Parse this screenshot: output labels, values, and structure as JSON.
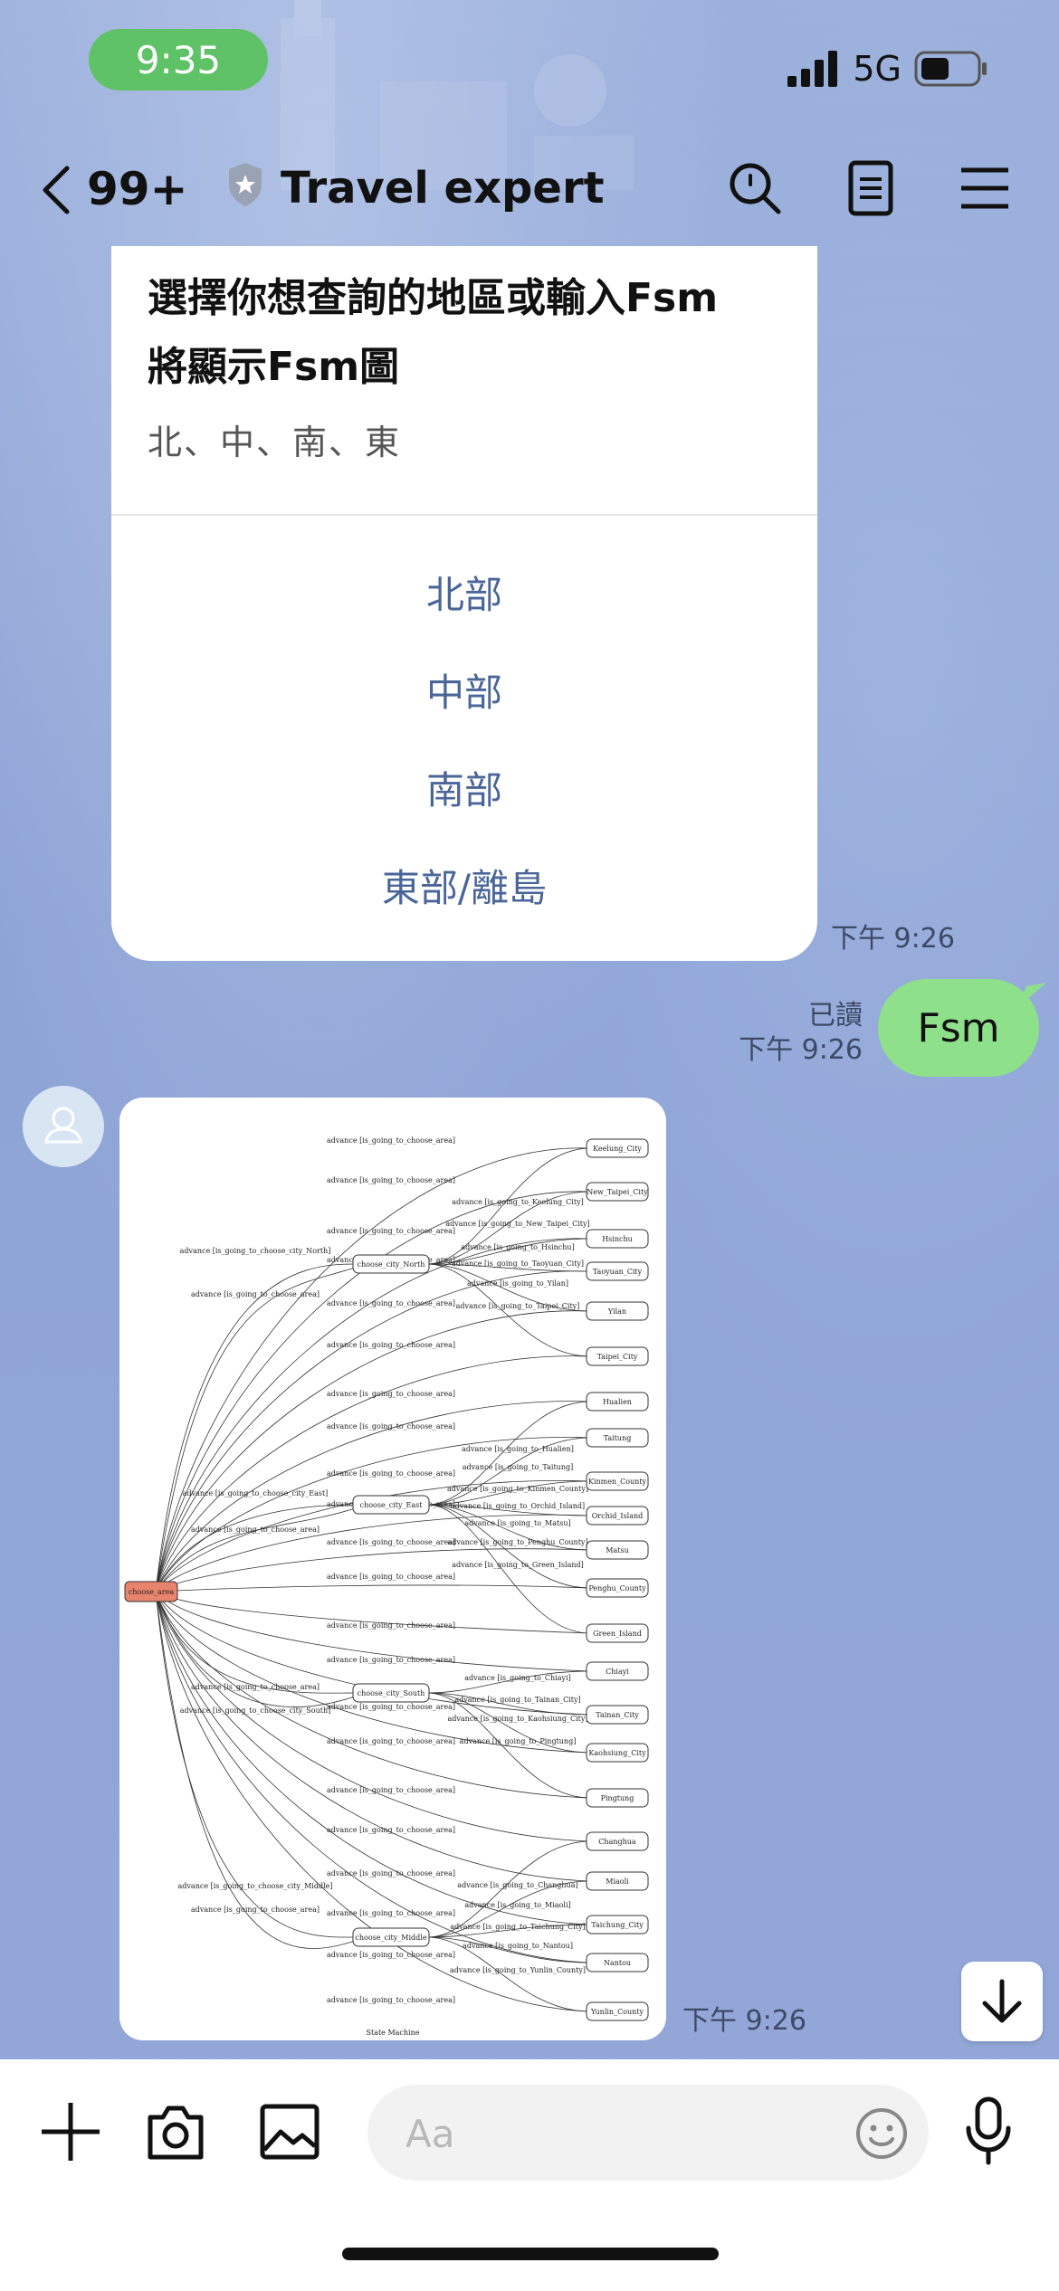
{
  "status": {
    "time": "9:35",
    "network": "5G"
  },
  "header": {
    "unread": "99+",
    "title": "Travel expert"
  },
  "card": {
    "title_line1": "選擇你想查詢的地區或輸入Fsm",
    "title_line2": "將顯示Fsm圖",
    "subtitle": "北、中、南、東",
    "options": [
      "北部",
      "中部",
      "南部",
      "東部/離島"
    ],
    "time": "下午 9:26"
  },
  "sent": {
    "text": "Fsm",
    "read": "已讀",
    "time": "下午 9:26"
  },
  "image_msg": {
    "time": "下午 9:26"
  },
  "fsm": {
    "root": "choose_area",
    "hubs": [
      "choose_city_North",
      "choose_city_East",
      "choose_city_South",
      "choose_city_Middle"
    ],
    "leaves": [
      "Keelung_City",
      "New_Taipei_City",
      "Hsinchu",
      "Taoyuan_City",
      "Yilan",
      "Taipei_City",
      "Hualien",
      "Taitung",
      "Kinmen_County",
      "Orchid_Island",
      "Matsu",
      "Penghu_County",
      "Green_Island",
      "Chiayi",
      "Tainan_City",
      "Kaohsiung_City",
      "Pingtung",
      "Changhua",
      "Miaoli",
      "Taichung_City",
      "Nantou",
      "Yunlin_County"
    ],
    "edge_back": "advance [is_going_to_choose_area]",
    "edge_north": "advance [is_going_to_choose_city_North]",
    "edge_east": "advance [is_going_to_choose_city_East]",
    "edge_south": "advance [is_going_to_choose_city_South]",
    "edge_middle": "advance [is_going_to_choose_city_Middle]",
    "leaf_edges": [
      "advance [is_going_to_Keelung_City]",
      "advance [is_going_to_New_Taipei_City]",
      "advance [is_going_to_Hsinchu]",
      "advance [is_going_to_Taoyuan_City]",
      "advance [is_going_to_Yilan]",
      "advance [is_going_to_Taipei_City]",
      "advance [is_going_to_Hualien]",
      "advance [is_going_to_Taitung]",
      "advance [is_going_to_Kinmen_County]",
      "advance [is_going_to_Orchid_Island]",
      "advance [is_going_to_Matsu]",
      "advance [is_going_to_Penghu_County]",
      "advance [is_going_to_Green_Island]",
      "advance [is_going_to_Chiayi]",
      "advance [is_going_to_Tainan_City]",
      "advance [is_going_to_Kaohsiung_City]",
      "advance [is_going_to_Pingtung]",
      "advance [is_going_to_Changhua]",
      "advance [is_going_to_Miaoli]",
      "advance [is_going_to_Taichung_City]",
      "advance [is_going_to_Nantou]",
      "advance [is_going_to_Yunlin_County]"
    ],
    "caption": "State Machine"
  },
  "composer": {
    "placeholder": "Aa"
  },
  "colors": {
    "accent_green": "#5fc267",
    "sent_bubble": "#8ee08a",
    "option_text": "#4a6699",
    "root_node": "#e8846e"
  }
}
